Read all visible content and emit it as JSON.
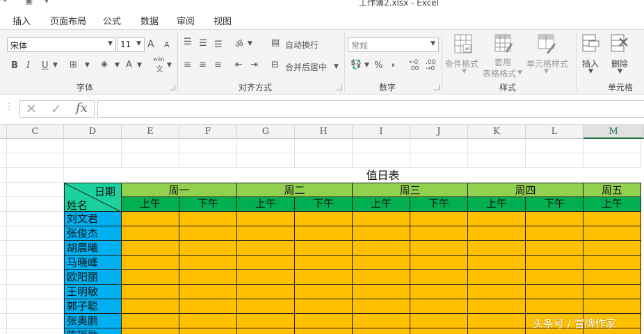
{
  "window": {
    "title": "工作簿2.xlsx - Excel"
  },
  "tabs": [
    "插入",
    "页面布局",
    "公式",
    "数据",
    "审阅",
    "视图"
  ],
  "ribbon": {
    "font_name": "宋体",
    "font_size": "11",
    "wrap_text": "自动换行",
    "merge_center": "合并后居中",
    "number_format": "常规",
    "percent": "%",
    "comma": ",",
    "bold": "B",
    "italic": "I",
    "underline": "U",
    "font_grow": "A",
    "font_shrink": "A",
    "font_color": "A",
    "phonetic": "wén",
    "phonetic_char": "文",
    "conditional_format": "条件格式",
    "format_table_1": "套用",
    "format_table_2": "表格格式",
    "cell_style": "单元格样式",
    "insert": "插入",
    "delete": "删除",
    "group_font": "字体",
    "group_align": "对齐方式",
    "group_number": "数字",
    "group_styles": "样式",
    "group_cells": "单元格"
  },
  "formula_bar": {
    "fx": "fx",
    "value": ""
  },
  "columns": [
    "C",
    "D",
    "E",
    "F",
    "G",
    "H",
    "I",
    "J",
    "K",
    "L",
    "M"
  ],
  "selected_column": "M",
  "sheet": {
    "title": "值日表",
    "corner_top": "日期",
    "corner_bottom": "姓名",
    "days": [
      "周一",
      "周二",
      "周三",
      "周四",
      "周五"
    ],
    "am": "上午",
    "pm": "下午",
    "names": [
      "刘文君",
      "张俊杰",
      "胡晨曦",
      "马晓峰",
      "欧阳丽",
      "王明敏",
      "郭子聪",
      "张奥鹏",
      "陈瑶勋"
    ]
  },
  "watermark": "头条号 / 冒牌作家",
  "colors": {
    "day_header": "#92d050",
    "halfday_header": "#00b050",
    "name_cells": "#00b0f0",
    "body_cells": "#ffc000",
    "corner": "#1bd29e",
    "accent": "#217346"
  }
}
